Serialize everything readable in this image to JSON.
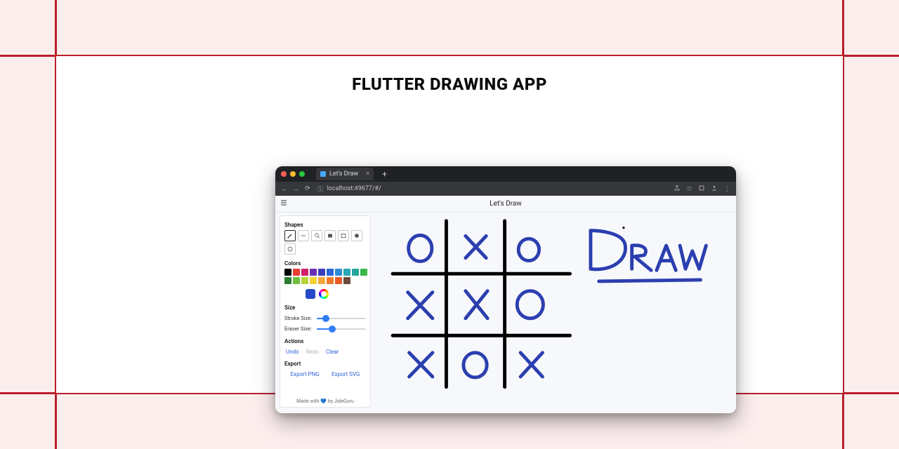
{
  "page_title": "FLUTTER DRAWING APP",
  "grid_color": "#b81f2c",
  "browser": {
    "tab": {
      "title": "Let's Draw"
    },
    "url": "localhost:49677/#/"
  },
  "app": {
    "title": "Let's Draw",
    "sidebar": {
      "shapes": {
        "label": "Shapes",
        "tools": [
          "pencil",
          "line",
          "fill",
          "rect-filled",
          "rect-outline",
          "circle-filled",
          "circle-outline"
        ],
        "selected": "pencil"
      },
      "colors": {
        "label": "Colors",
        "palette": [
          "#000000",
          "#e73c32",
          "#d11f6a",
          "#6a2fb0",
          "#3a3cb7",
          "#2a64d8",
          "#2f8bd6",
          "#2aa6b4",
          "#26a69a",
          "#39b54a",
          "#2e7d32",
          "#6fbf3f",
          "#b9d43a",
          "#f3d034",
          "#f2a93a",
          "#ef7a2a",
          "#ea5a2a",
          "#6a4a3b"
        ],
        "selected": "#2449c9"
      },
      "size": {
        "label": "Size",
        "stroke_label": "Stroke Size:",
        "eraser_label": "Eraser Size:",
        "stroke_pct": 18,
        "eraser_pct": 32
      },
      "actions": {
        "label": "Actions",
        "undo": "Undo",
        "redo": "Redo",
        "clear": "Clear",
        "redo_enabled": false
      },
      "export": {
        "label": "Export",
        "png": "Export PNG",
        "svg": "Export SVG"
      },
      "footer_prefix": "Made with ",
      "footer_suffix": " by JideGuru"
    },
    "canvas_text": "DRAW"
  }
}
